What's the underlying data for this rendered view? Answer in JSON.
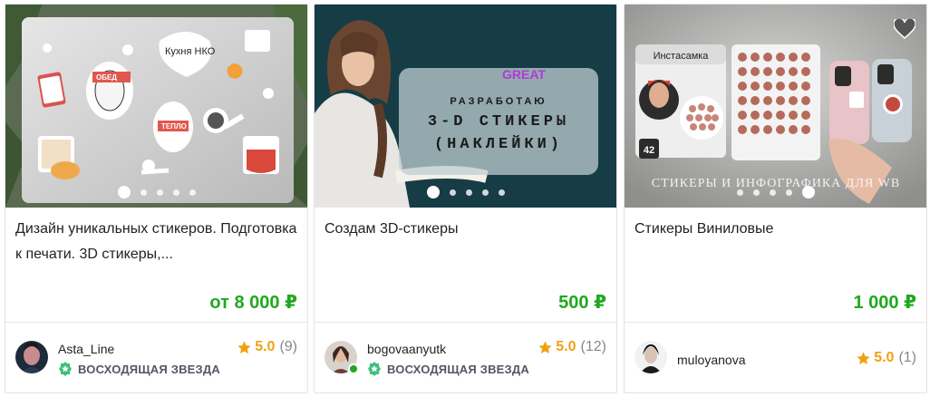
{
  "cards": [
    {
      "title": "Дизайн уникальных стикеров. Подготовка к печати. 3D стикеры,...",
      "price": "от 8 000 ₽",
      "seller": "Asta_Line",
      "badge": "ВОСХОДЯЩАЯ ЗВЕЗДА",
      "rating": "5.0",
      "reviews": "(9)",
      "image": {
        "sticker_labels": [
          "Кухня НКО",
          "ОБЕД",
          "ТЕПЛО"
        ]
      }
    },
    {
      "title": "Создам 3D-стикеры",
      "price": "500 ₽",
      "seller": "bogovaanyutk",
      "badge": "ВОСХОДЯЩАЯ ЗВЕЗДА",
      "rating": "5.0",
      "reviews": "(12)",
      "image": {
        "brand": "GREAT",
        "line1": "РАЗРАБОТАЮ",
        "line2": "3-D СТИКЕРЫ",
        "line3": "(НАКЛЕЙКИ)"
      }
    },
    {
      "title": "Стикеры Виниловые",
      "price": "1 000 ₽",
      "seller": "muloyanova",
      "rating": "5.0",
      "reviews": "(1)",
      "image": {
        "header": "Инстасамка",
        "count": "42",
        "caption": "СТИКЕРЫ И ИНФОГРАФИКА ДЛЯ WB"
      }
    }
  ],
  "colors": {
    "price": "#1fa91f",
    "star": "#f0a112",
    "online": "#1fa91f",
    "badge": "#3cc07c"
  },
  "icons": [
    "star-icon",
    "rising-star-badge-icon",
    "heart-icon"
  ]
}
